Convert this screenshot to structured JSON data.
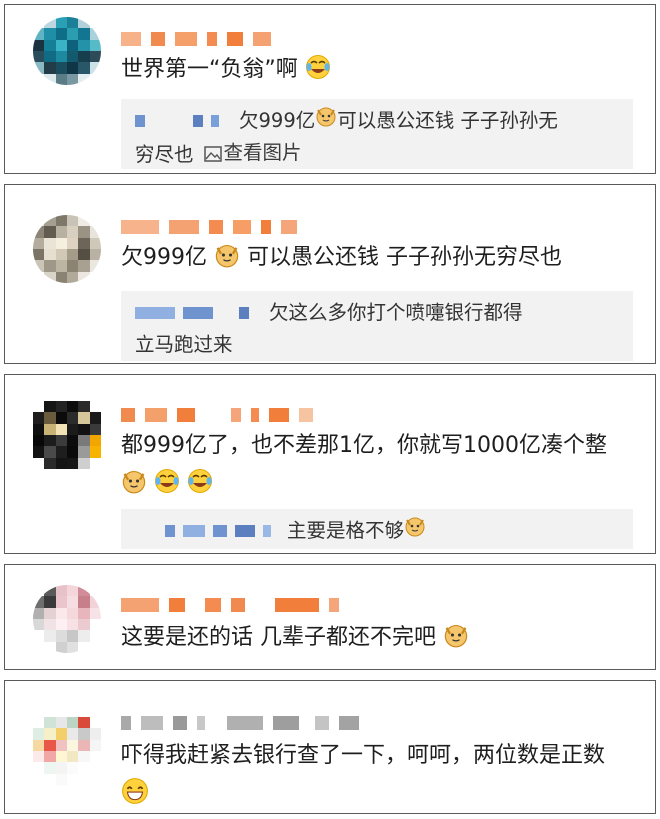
{
  "comments": [
    {
      "id": "c1",
      "text_before": "世界第一“负翁”啊",
      "emoji": "laughing-crying-icon",
      "quote": {
        "line1": "欠999亿",
        "line1_after": "可以愚公还钱 子子孙孙无",
        "line2": "穷尽也",
        "view_image": "查看图片"
      }
    },
    {
      "id": "c2",
      "text_before": "欠999亿",
      "text_after": "可以愚公还钱 子子孙孙无穷尽也",
      "quote": {
        "line1": "欠这么多你打个喷嚏银行都得",
        "line2": "立马跑过来"
      }
    },
    {
      "id": "c3",
      "text_line1": "都999亿了，也不差那1亿，你就写1000亿凑个整",
      "quote": {
        "line1": "主要是格不够"
      }
    },
    {
      "id": "c4",
      "text_before": "这要是还的话 几辈子都还不完吧"
    },
    {
      "id": "c5",
      "text_line1": "吓得我赶紧去银行查了一下，呵呵，两位数是正数"
    }
  ],
  "colors": {
    "border": "#5a5a5a",
    "quote_bg": "#f2f2f3",
    "name_orange": "#f4a06b",
    "name_gray": "#a9a9a9",
    "quote_blue": "#6f93cf"
  }
}
